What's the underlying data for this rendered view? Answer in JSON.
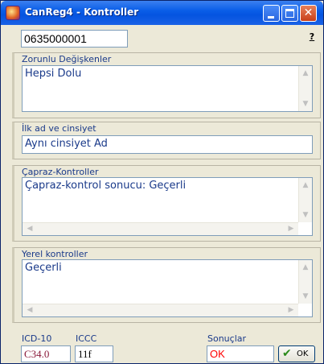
{
  "window": {
    "title": "CanReg4 - Kontroller",
    "close_glyph": "✕"
  },
  "record_id": "0635000001",
  "help_label": "?",
  "sections": {
    "mandatory": {
      "label": "Zorunlu Değişkenler",
      "text": "Hepsi Dolu"
    },
    "first_name_sex": {
      "label": "İlk ad ve cinsiyet",
      "text": "Aynı cinsiyet Ad"
    },
    "cross_checks": {
      "label": "Çapraz-Kontroller",
      "text": "Çapraz-kontrol sonucu: Geçerli"
    },
    "local_checks": {
      "label": "Yerel kontroller",
      "text": "Geçerli"
    }
  },
  "footer": {
    "icd10_label": "ICD-10",
    "icd10_value": "C34.0",
    "iccc_label": "ICCC",
    "iccc_value": "11f",
    "results_label": "Sonuçlar",
    "results_value": "OK",
    "ok_button_label": "OK"
  },
  "colors": {
    "titlebar": "#0554e0",
    "label_text": "#1a3a8a",
    "icd_value": "#8a1a3a",
    "result_ok": "#ff0000",
    "check_green": "#2a8a1a"
  }
}
